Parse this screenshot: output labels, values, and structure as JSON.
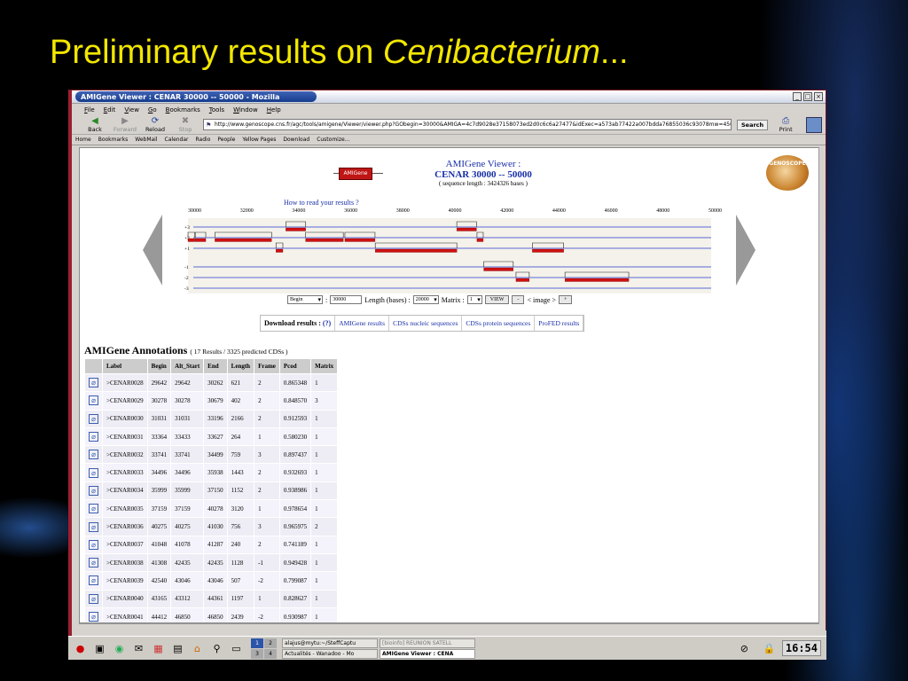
{
  "slide": {
    "title_prefix": "Preliminary results on ",
    "title_italic": "Cenibacterium",
    "title_suffix": "..."
  },
  "browser": {
    "window_title": "AMIGene Viewer : CENAR 30000 -- 50000 - Mozilla",
    "menu": [
      "File",
      "Edit",
      "View",
      "Go",
      "Bookmarks",
      "Tools",
      "Window",
      "Help"
    ],
    "nav": {
      "back": "Back",
      "forward": "Forward",
      "reload": "Reload",
      "stop": "Stop",
      "search": "Search",
      "print": "Print"
    },
    "url": "http://www.genoscope.cns.fr/agc/tools/amigene/Viewer/viewer.php?GObegin=30000&AMIGA=4c7d9028e37158073ed2d0c6c6a27477&idExec=a573ab77422a007bdda76855036c93078mw=450",
    "bookmarks": [
      "Home",
      "Bookmarks",
      "WebMail",
      "Calendar",
      "Radio",
      "People",
      "Yellow Pages",
      "Download",
      "Customize..."
    ]
  },
  "viewer": {
    "logo_text": "AMIGene",
    "genoscope": "GENOSCOPE",
    "title": "AMIGene Viewer :",
    "region": "CENAR 30000 -- 50000",
    "seq_length": "( sequence length : 3424326 bases )",
    "how_to": "How to read your results ?",
    "ruler": [
      "30000",
      "32000",
      "34000",
      "36000",
      "38000",
      "40000",
      "42000",
      "44000",
      "46000",
      "48000",
      "50000"
    ],
    "frames": [
      "+3",
      "+2",
      "+1",
      "-1",
      "-2",
      "-3"
    ],
    "controls": {
      "begin_select": "Begin",
      "begin_value": "30000",
      "length_label": "Length (bases) :",
      "length_select": "20000",
      "matrix_label": "Matrix :",
      "matrix_select": "1",
      "view_btn": "VIEW",
      "minus_btn": "-",
      "image_label": "< image >",
      "plus_btn": "+"
    }
  },
  "downloads": {
    "head": "Download results :",
    "help": "(?)",
    "links": [
      "AMIGene results",
      "CDSs nucleic sequences",
      "CDSs protein sequences",
      "ProFED results"
    ]
  },
  "annotations": {
    "title": "AMIGene Annotations",
    "subtitle": "( 17 Results / 3325 predicted CDSs )",
    "columns": [
      "Label",
      "Begin",
      "Alt_Start",
      "End",
      "Length",
      "Frame",
      "Pcod",
      "Matrix"
    ],
    "rows": [
      [
        ">CENAR0028",
        "29642",
        "29642",
        "30262",
        "621",
        "2",
        "0.865348",
        "1"
      ],
      [
        ">CENAR0029",
        "30278",
        "30278",
        "30679",
        "402",
        "2",
        "0.848570",
        "3"
      ],
      [
        ">CENAR0030",
        "31031",
        "31031",
        "33196",
        "2166",
        "2",
        "0.912593",
        "1"
      ],
      [
        ">CENAR0031",
        "33364",
        "33433",
        "33627",
        "264",
        "1",
        "0.580230",
        "1"
      ],
      [
        ">CENAR0032",
        "33741",
        "33741",
        "34499",
        "759",
        "3",
        "0.897437",
        "1"
      ],
      [
        ">CENAR0033",
        "34496",
        "34496",
        "35938",
        "1443",
        "2",
        "0.932693",
        "1"
      ],
      [
        ">CENAR0034",
        "35999",
        "35999",
        "37150",
        "1152",
        "2",
        "0.938986",
        "1"
      ],
      [
        ">CENAR0035",
        "37159",
        "37159",
        "40278",
        "3120",
        "1",
        "0.978654",
        "1"
      ],
      [
        ">CENAR0036",
        "40275",
        "40275",
        "41030",
        "756",
        "3",
        "0.965975",
        "2"
      ],
      [
        ">CENAR0037",
        "41048",
        "41078",
        "41287",
        "240",
        "2",
        "0.741189",
        "1"
      ],
      [
        ">CENAR0038",
        "41308",
        "42435",
        "42435",
        "1128",
        "-1",
        "0.949428",
        "1"
      ],
      [
        ">CENAR0039",
        "42540",
        "43046",
        "43046",
        "507",
        "-2",
        "0.799087",
        "1"
      ],
      [
        ">CENAR0040",
        "43165",
        "43312",
        "44361",
        "1197",
        "1",
        "0.828627",
        "1"
      ],
      [
        ">CENAR0041",
        "44412",
        "46850",
        "46850",
        "2439",
        "-2",
        "0.930987",
        "1"
      ]
    ]
  },
  "taskbar": {
    "pager": [
      "1",
      "2",
      "3",
      "4"
    ],
    "tasks": [
      "alajus@mytu:~/SteffCaptu",
      "[bioinfo] REUNION SATELL",
      "Actualités - Wanadoo - Mo",
      "AMIGene Viewer : CENA"
    ],
    "clock": "16:54"
  },
  "colors": {
    "title": "#f2e600",
    "cds_red": "#d01010",
    "frame_blue": "#2a3ad0"
  }
}
